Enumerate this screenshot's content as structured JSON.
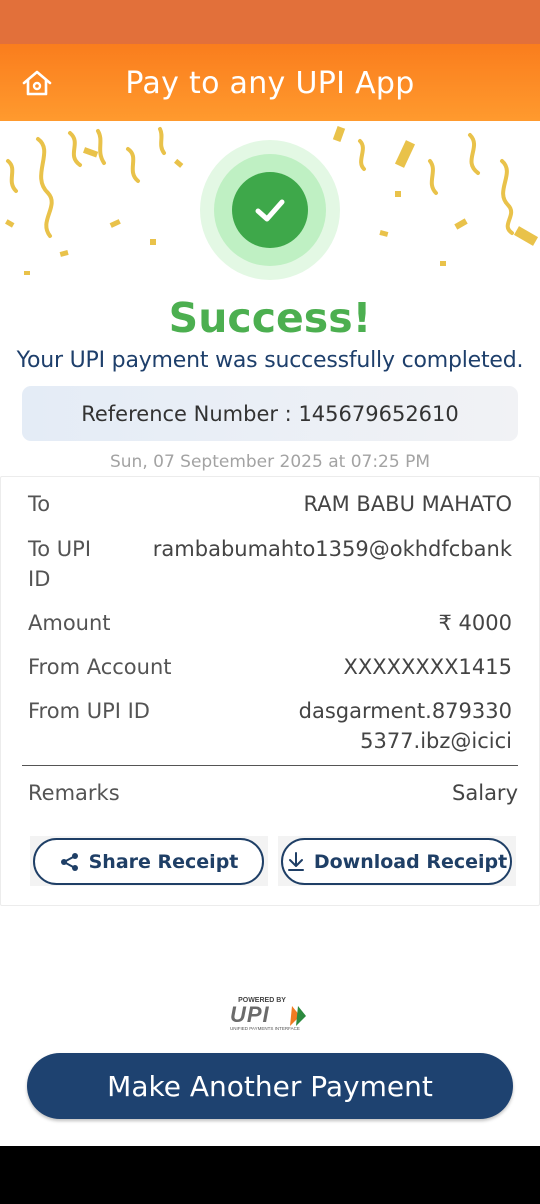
{
  "header": {
    "title": "Pay to any UPI App",
    "home_icon": "home-icon"
  },
  "colors": {
    "accent": "#fa7d1d",
    "success": "#4caf50",
    "primary": "#1e4270",
    "text_blue": "#1e3f6b"
  },
  "status": {
    "title": "Success!",
    "message": "Your UPI payment was successfully completed.",
    "icon": "check-circle-icon"
  },
  "reference": {
    "label": "Reference Number : ",
    "number": "145679652610"
  },
  "datetime": "Sun, 07 September 2025 at 07:25 PM",
  "details": {
    "to_label": "To",
    "to_value": "RAM BABU MAHATO",
    "upi_label_line1": "To UPI",
    "upi_label_line2": "ID",
    "upi_value": "rambabumahto1359@okhdfcbank",
    "amount_label": "Amount",
    "amount_value": "₹ 4000",
    "from_account_label": "From Account",
    "from_account_value": "XXXXXXXX1415",
    "from_upi_label": "From UPI ID",
    "from_upi_value_line1": "dasgarment.879330",
    "from_upi_value_line2": "5377.ibz@icici",
    "remarks_label": "Remarks",
    "remarks_value": "Salary"
  },
  "buttons": {
    "share": "Share Receipt",
    "download": "Download Receipt",
    "share_icon": "share-icon",
    "download_icon": "download-icon"
  },
  "upi_logo": {
    "powered_by": "POWERED BY",
    "brand": "UPI",
    "tagline": "UNIFIED PAYMENTS INTERFACE"
  },
  "footer": {
    "make_payment": "Make Another Payment"
  }
}
